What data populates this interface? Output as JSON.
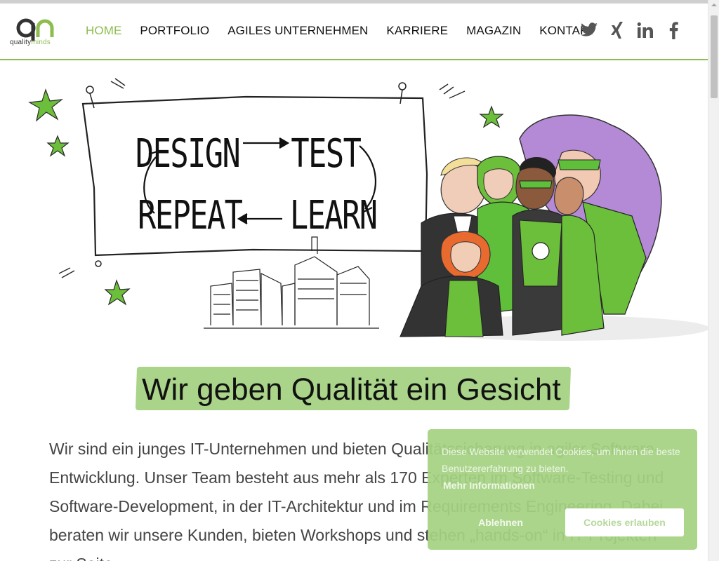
{
  "logo": {
    "text_main": "quality",
    "text_accent": "minds"
  },
  "nav": {
    "items": [
      {
        "label": "HOME",
        "active": true
      },
      {
        "label": "PORTFOLIO",
        "active": false
      },
      {
        "label": "AGILES UNTERNEHMEN",
        "active": false
      },
      {
        "label": "KARRIERE",
        "active": false
      },
      {
        "label": "MAGAZIN",
        "active": false
      },
      {
        "label": "KONTAKT",
        "active": false
      }
    ]
  },
  "social": {
    "icons": [
      "twitter-icon",
      "xing-icon",
      "linkedin-icon",
      "facebook-icon"
    ]
  },
  "hero": {
    "words": {
      "design": "DESIGN",
      "test": "TEST",
      "repeat": "REPEAT",
      "learn": "LEARN"
    }
  },
  "headline": "Wir geben Qualität ein Gesicht",
  "intro": "Wir sind ein junges IT-Unternehmen und bieten Qualitätssicherung in agiler Software-Entwicklung. Unser Team besteht aus mehr als 170 Experten im Software-Testing und Software-Development, in der IT-Architektur und im Requirements Engineering. Dabei beraten wir unsere Kunden, bieten Workshops und stehen „hands-on“ in IT-Projekten zur Seite.",
  "cookie": {
    "text": "Diese Website verwendet Cookies, um Ihnen die beste Benutzererfahrung zu bieten.",
    "more": "Mehr Informationen",
    "reject": "Ablehnen",
    "accept": "Cookies erlauben"
  },
  "colors": {
    "accent": "#8dbd4f",
    "headline_bg": "#a9d48a",
    "cookie_bg": "#a5d282",
    "social_icon": "#555555"
  }
}
